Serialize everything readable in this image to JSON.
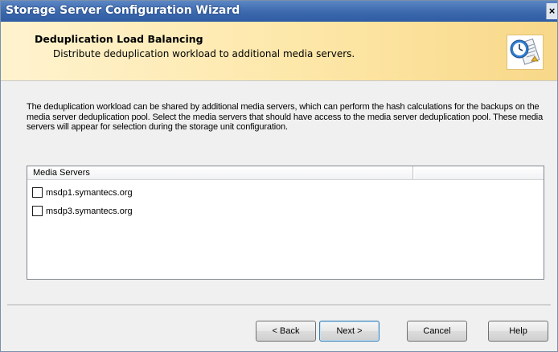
{
  "window": {
    "title": "Storage Server Configuration Wizard",
    "close_glyph": "×"
  },
  "header": {
    "title": "Deduplication Load Balancing",
    "subtitle": "Distribute deduplication workload to additional media servers.",
    "icon": "wizard-clock-document-icon"
  },
  "intro_text": "The deduplication workload can be shared by additional media servers, which can perform the hash calculations for the backups on the media server deduplication pool. Select the media servers that should have access to the media server deduplication pool. These media servers will appear for selection during the storage unit configuration.",
  "media_list": {
    "column_header": "Media Servers",
    "items": [
      {
        "label": "msdp1.symantecs.org",
        "checked": false
      },
      {
        "label": "msdp3.symantecs.org",
        "checked": false
      }
    ]
  },
  "buttons": {
    "back": "< Back",
    "next": "Next >",
    "cancel": "Cancel",
    "help": "Help"
  },
  "colors": {
    "titlebar": "#3c68ad",
    "header_band": "#fde7a8",
    "dialog_bg": "#f0f0f0"
  }
}
